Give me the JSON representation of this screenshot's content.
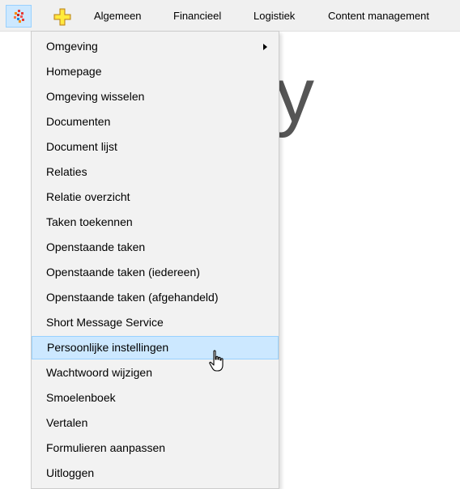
{
  "menubar": {
    "logo_icon": "app-logo-icon",
    "add_icon": "plus-icon",
    "items": [
      {
        "label": "Algemeen"
      },
      {
        "label": "Financieel"
      },
      {
        "label": "Logistiek"
      },
      {
        "label": "Content management"
      }
    ]
  },
  "background": {
    "fragment": "y"
  },
  "dropdown": {
    "items": [
      {
        "label": "Omgeving",
        "has_submenu": true
      },
      {
        "label": "Homepage"
      },
      {
        "label": "Omgeving wisselen"
      },
      {
        "label": "Documenten"
      },
      {
        "label": "Document lijst"
      },
      {
        "label": "Relaties"
      },
      {
        "label": "Relatie overzicht"
      },
      {
        "label": "Taken toekennen"
      },
      {
        "label": "Openstaande taken"
      },
      {
        "label": "Openstaande taken (iedereen)"
      },
      {
        "label": "Openstaande taken (afgehandeld)"
      },
      {
        "label": "Short Message Service"
      },
      {
        "label": "Persoonlijke instellingen",
        "hovered": true
      },
      {
        "label": "Wachtwoord wijzigen"
      },
      {
        "label": "Smoelenboek"
      },
      {
        "label": "Vertalen"
      },
      {
        "label": "Formulieren aanpassen"
      },
      {
        "label": "Uitloggen"
      }
    ]
  },
  "colors": {
    "hover_bg": "#cce8ff",
    "hover_border": "#99d1ff",
    "menubar_bg": "#f0f0f0",
    "dropdown_bg": "#f2f2f2"
  }
}
